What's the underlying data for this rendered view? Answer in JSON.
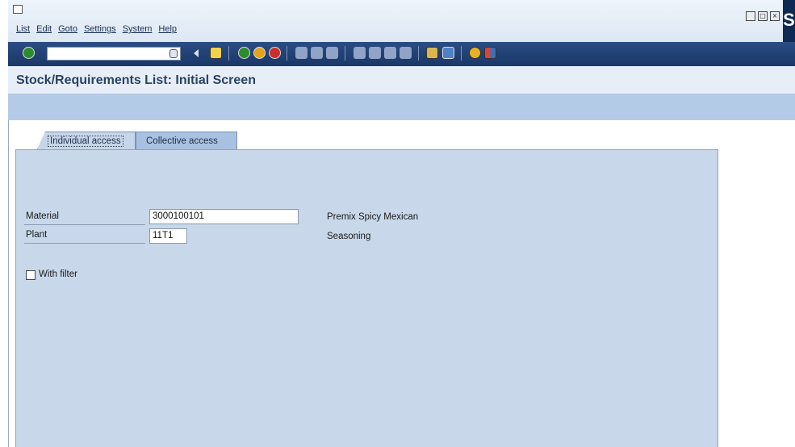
{
  "window": {
    "menu": [
      "List",
      "Edit",
      "Goto",
      "Settings",
      "System",
      "Help"
    ],
    "controls": [
      "minimize-icon",
      "maximize-icon",
      "close-icon"
    ],
    "logo_letter": "S"
  },
  "toolbar": {
    "icons": [
      "enter-check-icon",
      "save-icon",
      "back-icon",
      "exit-icon",
      "cancel-icon",
      "print-icon",
      "find-icon",
      "find-next-icon",
      "first-page-icon",
      "previous-page-icon",
      "next-page-icon",
      "last-page-icon",
      "create-session-icon",
      "shortcut-icon",
      "help-icon",
      "layout-icon"
    ]
  },
  "screen": {
    "title": "Stock/Requirements List: Initial Screen"
  },
  "tabs": [
    {
      "label": "Individual access",
      "active": true
    },
    {
      "label": "Collective access",
      "active": false
    }
  ],
  "form": {
    "material_label": "Material",
    "material_value": "3000100101",
    "material_desc_line1": "Premix Spicy Mexican",
    "plant_label": "Plant",
    "plant_value": "11T1",
    "material_desc_line2": "Seasoning",
    "filter_label": "With filter",
    "filter_checked": false
  },
  "colors": {
    "toolbar": "#1f3c6d",
    "panel": "#c8d8ea",
    "app_toolbar": "#b4cbe7",
    "title_text": "#2a4265"
  }
}
